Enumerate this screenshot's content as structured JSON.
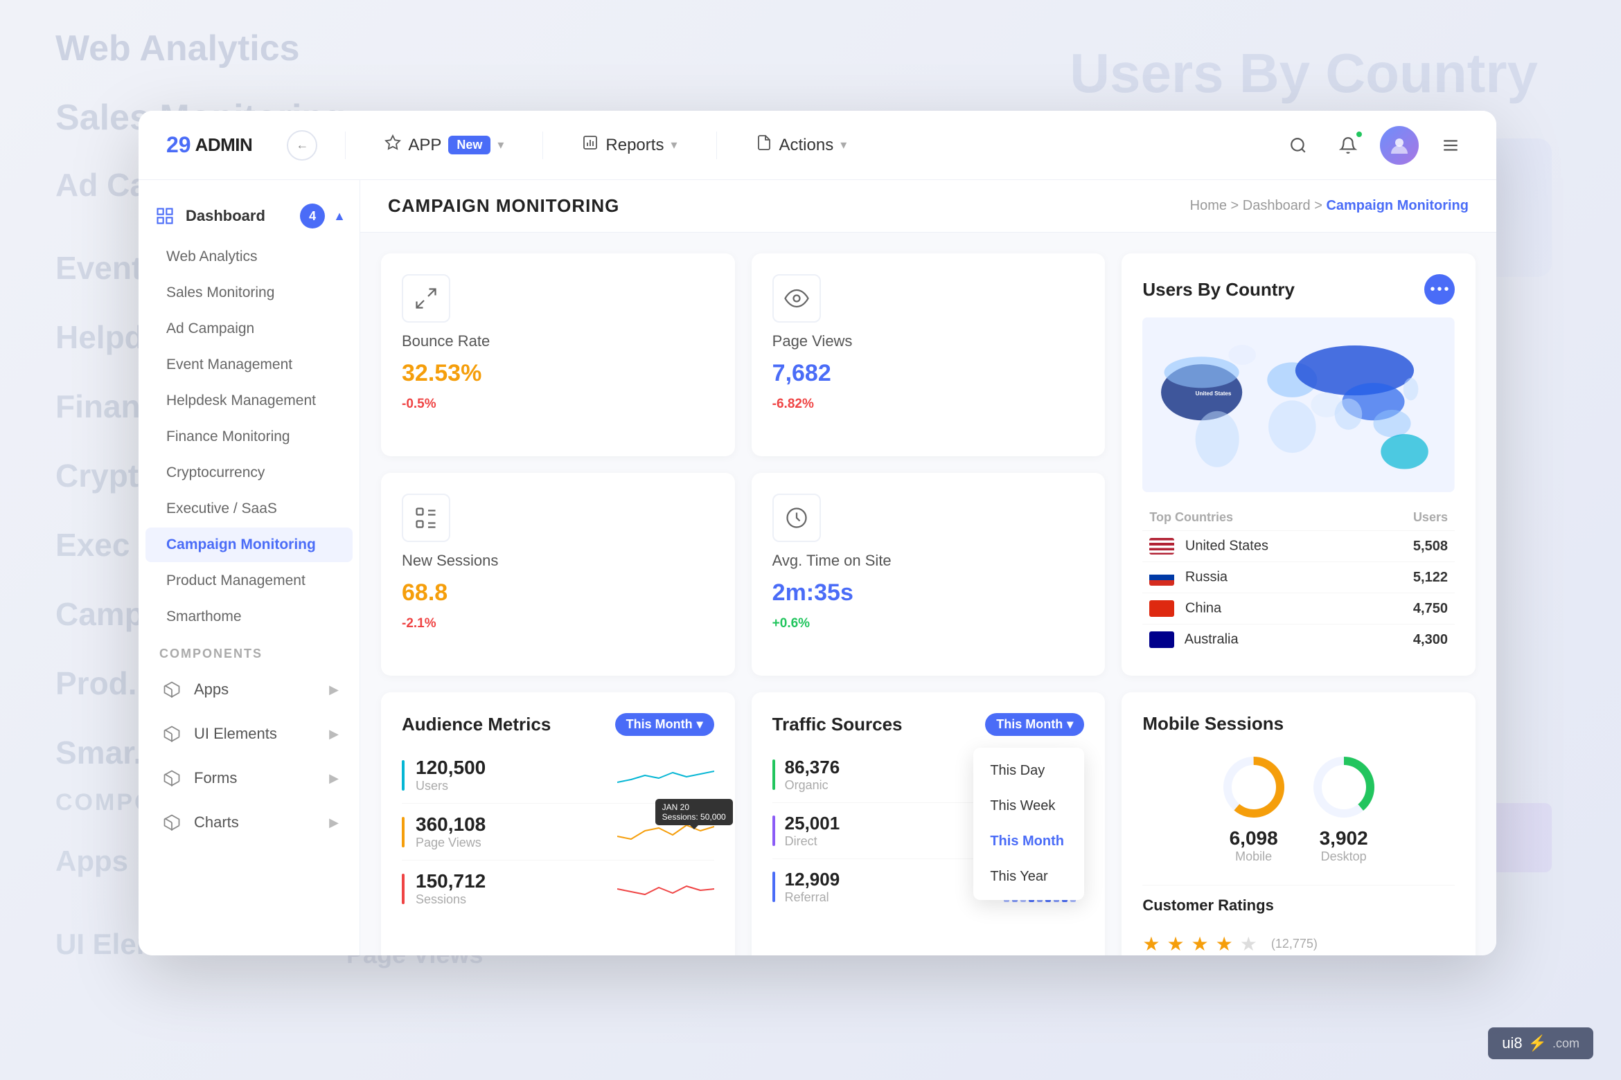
{
  "brand": {
    "num": "29",
    "text": "ADMIN"
  },
  "navbar": {
    "app_label": "APP",
    "new_badge": "New",
    "reports_label": "Reports",
    "actions_label": "Actions",
    "search_placeholder": "Search..."
  },
  "sidebar": {
    "dashboard_label": "Dashboard",
    "dashboard_badge": "4",
    "items": [
      {
        "label": "Web Analytics"
      },
      {
        "label": "Sales Monitoring"
      },
      {
        "label": "Ad Campaign"
      },
      {
        "label": "Event Management"
      },
      {
        "label": "Helpdesk Management"
      },
      {
        "label": "Finance Monitoring"
      },
      {
        "label": "Cryptocurrency"
      },
      {
        "label": "Executive / SaaS"
      },
      {
        "label": "Campaign Monitoring",
        "active": true
      },
      {
        "label": "Product Management"
      },
      {
        "label": "Smarthome"
      }
    ],
    "components_label": "COMPONENTS",
    "component_items": [
      {
        "label": "Apps"
      },
      {
        "label": "UI Elements"
      },
      {
        "label": "Forms"
      },
      {
        "label": "Charts"
      }
    ]
  },
  "page": {
    "title": "CAMPAIGN MONITORING",
    "breadcrumb": {
      "home": "Home",
      "dashboard": "Dashboard",
      "active": "Campaign Monitoring"
    }
  },
  "stats": {
    "bounce_rate": {
      "label": "Bounce Rate",
      "value": "32.53%",
      "change": "-0.5%",
      "positive": false
    },
    "page_views": {
      "label": "Page Views",
      "value": "7,682",
      "change": "-6.82%",
      "positive": false
    },
    "new_sessions": {
      "label": "New Sessions",
      "value": "68.8",
      "change": "-2.1%",
      "positive": false
    },
    "avg_time": {
      "label": "Avg. Time on Site",
      "value": "2m:35s",
      "change": "+0.6%",
      "positive": true
    }
  },
  "users_by_country": {
    "title": "Users By Country",
    "table_headers": [
      "Top Countries",
      "Users"
    ],
    "countries": [
      {
        "name": "United States",
        "users": "5,508",
        "flag": "us"
      },
      {
        "name": "Russia",
        "users": "5,122",
        "flag": "ru"
      },
      {
        "name": "China",
        "users": "4,750",
        "flag": "cn"
      },
      {
        "name": "Australia",
        "users": "4,300",
        "flag": "au"
      }
    ]
  },
  "audience_metrics": {
    "title": "Audience Metrics",
    "filter": "This Month",
    "rows": [
      {
        "value": "120,500",
        "label": "Users",
        "color": "#06b6d4"
      },
      {
        "value": "360,108",
        "label": "Page Views",
        "color": "#f59e0b"
      },
      {
        "value": "150,712",
        "label": "Sessions",
        "color": "#ef4444"
      }
    ],
    "tooltip": {
      "date": "JAN 20",
      "value": "Sessions: 50,000"
    }
  },
  "traffic_sources": {
    "title": "Traffic Sources",
    "filter": "This Month",
    "dropdown_items": [
      "This Day",
      "This Week",
      "This Month",
      "This Year"
    ],
    "rows": [
      {
        "value": "86,376",
        "label": "Organic",
        "color": "#22c55e"
      },
      {
        "value": "25,001",
        "label": "Direct",
        "color": "#8b5cf6"
      },
      {
        "value": "12,909",
        "label": "Referral",
        "color": "#4a6cf7"
      }
    ]
  },
  "mobile_sessions": {
    "title": "Mobile Sessions",
    "mobile_value": "6,098",
    "mobile_label": "Mobile",
    "desktop_value": "3,902",
    "desktop_label": "Desktop",
    "mobile_pct": 61,
    "desktop_pct": 39,
    "customer_ratings_title": "Customer Ratings",
    "rating": 3.5,
    "ratings_count": "(12,775)"
  },
  "colors": {
    "primary": "#4a6cf7",
    "success": "#22c55e",
    "warning": "#f59e0b",
    "danger": "#ef4444",
    "cyan": "#06b6d4",
    "purple": "#8b5cf6"
  },
  "watermark": {
    "text": "ui8.com ⚡"
  }
}
